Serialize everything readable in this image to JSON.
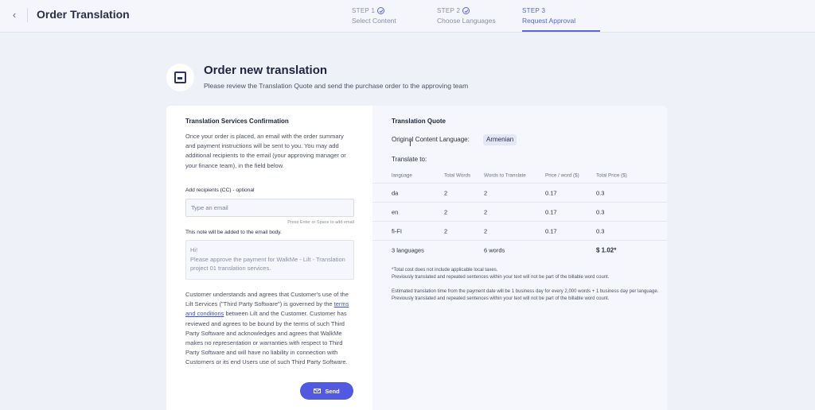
{
  "header": {
    "back_icon": "chevron-left-icon",
    "title": "Order Translation",
    "steps": [
      {
        "num": "STEP 1",
        "label": "Select Content",
        "done": true
      },
      {
        "num": "STEP 2",
        "label": "Choose Languages",
        "done": true
      },
      {
        "num": "STEP 3",
        "label": "Request Approval",
        "done": false,
        "active": true
      }
    ]
  },
  "intro": {
    "title": "Order new translation",
    "subtitle": "Please review the Translation Quote and send the purchase order to the approving team"
  },
  "confirmation": {
    "title": "Translation Services Confirmation",
    "text": "Once your order is placed, an email with the order summary and payment instructions will be sent to you. You may add additional recipients to the email (your approving manager or your finance team), in the field below.",
    "cc_label": "Add recipients (CC) - optional",
    "email_placeholder": "Type an email",
    "hint": "Press Enter or Space to add email",
    "note_label": "This note will be added to the email body.",
    "note_line1": "Hi!",
    "note_line2": "Please approve the payment for WalkMe - Lilt - Translation project 01 translation services.",
    "terms_before": "Customer understands and agrees that Customer's use of the Lilt Services (\"Third Party Software\") is governed by the ",
    "terms_link": "terms and conditions",
    "terms_after": " between Lilt and the Customer. Customer has reviewed and agrees to be bound by the terms of such Third Party Software and acknowledges and agrees that WalkMe makes no representation or warranties with respect to Third Party Software and will have no liability in connection with Customers or its end Users use of such Third Party Software.",
    "send_label": "Send"
  },
  "quote": {
    "title": "Translation Quote",
    "original_label": "Original Content Language:",
    "original_language": "Armenian",
    "translate_to": "Translate to:",
    "columns": [
      "language",
      "Total Words",
      "Words to Translate",
      "Price / word ($)",
      "Total Price ($)"
    ],
    "rows": [
      {
        "lang": "da",
        "total": "2",
        "translate": "2",
        "price": "0.17",
        "total_price": "0.3"
      },
      {
        "lang": "en",
        "total": "2",
        "translate": "2",
        "price": "0.17",
        "total_price": "0.3"
      },
      {
        "lang": "fi-FI",
        "total": "2",
        "translate": "2",
        "price": "0.17",
        "total_price": "0.3"
      }
    ],
    "summary": {
      "languages": "3 languages",
      "words": "6 words",
      "price": "$ 1.02*"
    },
    "note1": "*Total cost does not include applicable local taxes.",
    "note2": "Previously translated and repeated sentences within your text will not be part of the billable word count.",
    "note3": "Estimated translation time from the payment date will be 1 business day for every 2,000 words + 1 business day per language.",
    "note4": "Previously translated and repeated sentences within your text will not be part of the billable word count."
  },
  "colors": {
    "accent": "#5a63e0",
    "button": "#5159e0",
    "background": "#eef1f8"
  }
}
